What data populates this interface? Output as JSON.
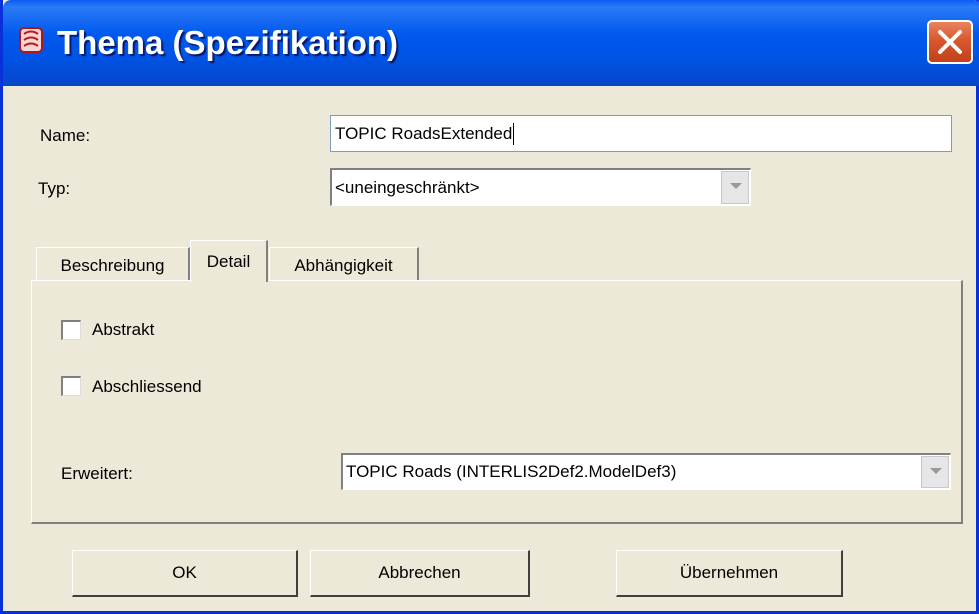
{
  "window": {
    "title": "Thema (Spezifikation)"
  },
  "form": {
    "name_label": "Name:",
    "name_value": "TOPIC RoadsExtended",
    "type_label": "Typ:",
    "type_value": "<uneingeschränkt>"
  },
  "tabs": [
    {
      "label": "Beschreibung",
      "active": false
    },
    {
      "label": "Detail",
      "active": true
    },
    {
      "label": "Abhängigkeit",
      "active": false
    }
  ],
  "detail": {
    "abstract_label": "Abstrakt",
    "abstract_checked": false,
    "final_label": "Abschliessend",
    "final_checked": false,
    "extends_label": "Erweitert:",
    "extends_value": "TOPIC Roads (INTERLIS2Def2.ModelDef3)"
  },
  "buttons": {
    "ok": "OK",
    "cancel": "Abbrechen",
    "apply": "Übernehmen"
  },
  "icons": {
    "app": "app-icon",
    "close": "close-icon",
    "dropdown": "chevron-down-icon"
  },
  "colors": {
    "titlebar": "#0054e3",
    "close": "#d9582e",
    "face": "#ece9d8"
  }
}
